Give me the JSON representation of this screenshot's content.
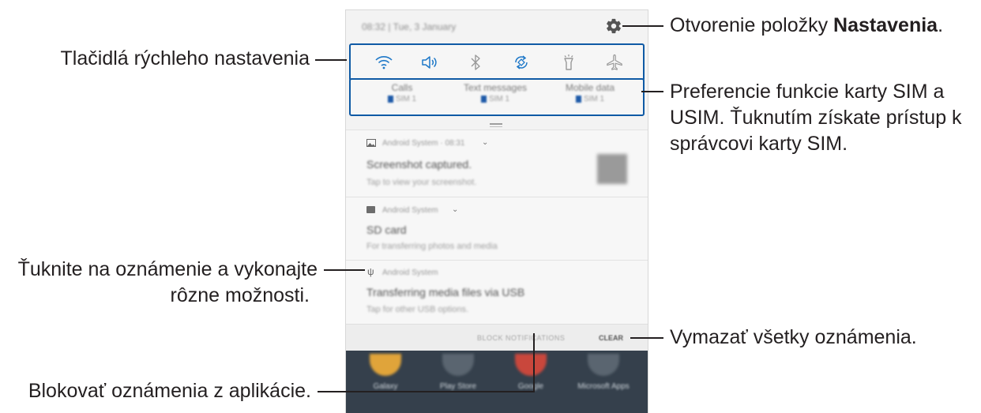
{
  "phone": {
    "status_text": "08:32 | Tue, 3 January",
    "sim_preferences": [
      {
        "label": "Calls",
        "sim": "SIM 1"
      },
      {
        "label": "Text messages",
        "sim": "SIM 1"
      },
      {
        "label": "Mobile data",
        "sim": "SIM 1"
      }
    ],
    "notifications": [
      {
        "app": "Android System · 08:31",
        "title": "Screenshot captured.",
        "subtitle": "Tap to view your screenshot."
      },
      {
        "app": "Android System",
        "title": "SD card",
        "subtitle": "For transferring photos and media"
      },
      {
        "app": "Android System",
        "title": "Transferring media files via USB",
        "subtitle": "Tap for other USB options."
      }
    ],
    "block_notifications_label": "BLOCK NOTIFICATIONS",
    "clear_label": "CLEAR",
    "home_apps": [
      "Galaxy",
      "Play Store",
      "Google",
      "Microsoft Apps"
    ]
  },
  "callouts": {
    "quick_settings": "Tlačidlá rýchleho nastavenia",
    "settings_prefix": "Otvorenie položky ",
    "settings_bold": "Nastavenia",
    "settings_suffix": ".",
    "sim_line1": "Preferencie funkcie karty SIM a",
    "sim_line2": "USIM. Ťuknutím získate prístup k",
    "sim_line3": "správcovi karty SIM.",
    "notification_line1": "Ťuknite na oznámenie a vykonajte",
    "notification_line2": "rôzne možnosti.",
    "clear_all": "Vymazať všetky oznámenia.",
    "block": "Blokovať oznámenia z aplikácie."
  }
}
